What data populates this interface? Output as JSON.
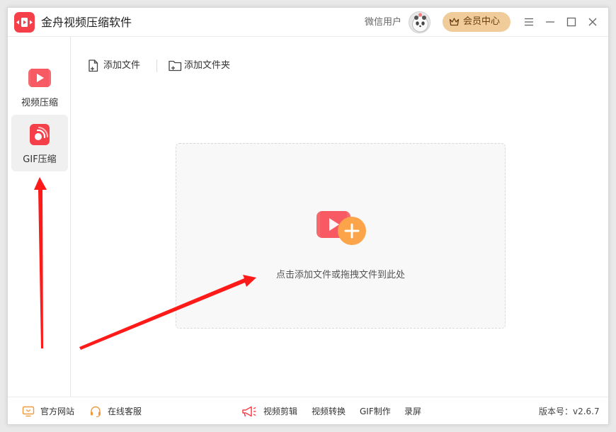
{
  "app": {
    "title": "金舟视频压缩软件"
  },
  "header": {
    "user_label": "微信用户",
    "vip_label": "会员中心"
  },
  "sidebar": {
    "items": [
      {
        "label": "视频压缩",
        "active": false
      },
      {
        "label": "GIF压缩",
        "active": true
      }
    ]
  },
  "toolbar": {
    "add_file": "添加文件",
    "add_folder": "添加文件夹"
  },
  "dropzone": {
    "hint": "点击添加文件或拖拽文件到此处"
  },
  "statusbar": {
    "website": "官方网站",
    "support": "在线客服",
    "tools": [
      "视频剪辑",
      "视频转换",
      "GIF制作",
      "录屏"
    ],
    "version": "版本号：v2.6.7"
  },
  "colors": {
    "brand_red": "#f5404a",
    "vip_gold": "#f1cc9b",
    "accent_orange": "#fba44a",
    "annotation_red": "#ff1a1a"
  }
}
